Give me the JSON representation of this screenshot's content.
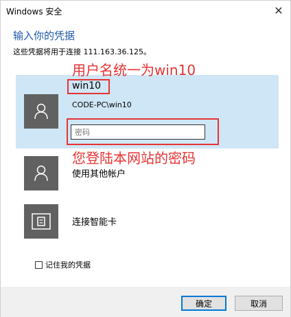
{
  "window": {
    "title": "Windows 安全",
    "close_glyph": "✕"
  },
  "header": {
    "title": "输入你的凭据",
    "subtitle": "这些凭据将用于连接 111.163.36.125。"
  },
  "credential": {
    "username": "win10",
    "account": "CODE-PC\\win10",
    "password_placeholder": "密码",
    "password_value": ""
  },
  "annotations": {
    "username_note": "用户名统一为win10",
    "password_note": "您登陆本网站的密码",
    "color": "#e53333"
  },
  "options": [
    {
      "label": "使用其他帐户",
      "icon": "user-icon"
    },
    {
      "label": "连接智能卡",
      "icon": "smartcard-icon"
    }
  ],
  "remember": {
    "label": "记住我的凭据",
    "checked": false
  },
  "buttons": {
    "ok": "确定",
    "cancel": "取消"
  },
  "colors": {
    "heading": "#1e5aa8",
    "selected_bg": "#cfe6f6",
    "avatar_bg": "#616161",
    "annotation": "#e53333",
    "footer_bg": "#f0f0f0"
  }
}
